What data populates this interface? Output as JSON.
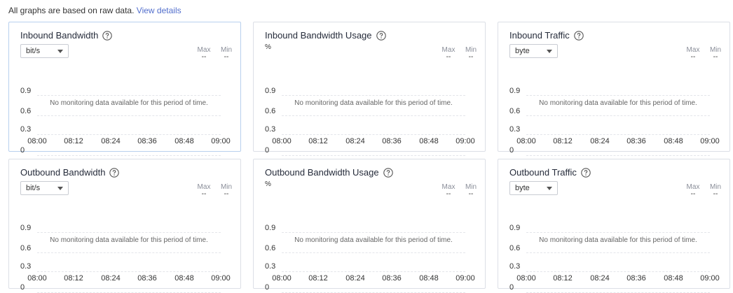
{
  "notice": {
    "text": "All graphs are based on raw data.",
    "link": "View details"
  },
  "max_label": "Max",
  "min_label": "Min",
  "empty_value": "--",
  "empty_message": "No monitoring data available for this period of time.",
  "y_ticks": [
    "0.9",
    "0.6",
    "0.3",
    "0"
  ],
  "x_ticks": [
    "08:00",
    "08:12",
    "08:24",
    "08:36",
    "08:48",
    "09:00"
  ],
  "cards": [
    {
      "title": "Inbound Bandwidth",
      "unit": "bit/s",
      "unit_type": "select",
      "focused": true
    },
    {
      "title": "Inbound Bandwidth Usage",
      "unit": "%",
      "unit_type": "static"
    },
    {
      "title": "Inbound Traffic",
      "unit": "byte",
      "unit_type": "select"
    },
    {
      "title": "Outbound Bandwidth",
      "unit": "bit/s",
      "unit_type": "select"
    },
    {
      "title": "Outbound Bandwidth Usage",
      "unit": "%",
      "unit_type": "static"
    },
    {
      "title": "Outbound Traffic",
      "unit": "byte",
      "unit_type": "select"
    }
  ]
}
